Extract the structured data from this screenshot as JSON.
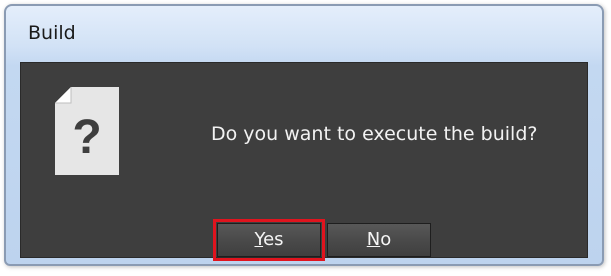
{
  "window": {
    "title": "Build"
  },
  "dialog": {
    "icon": "question-document-icon",
    "message": "Do you want to execute the build?"
  },
  "buttons": {
    "yes_mnemonic": "Y",
    "yes_rest": "es",
    "no_mnemonic": "N",
    "no_rest": "o"
  },
  "colors": {
    "highlight": "#e0141e",
    "panel": "#3e3e3e"
  }
}
